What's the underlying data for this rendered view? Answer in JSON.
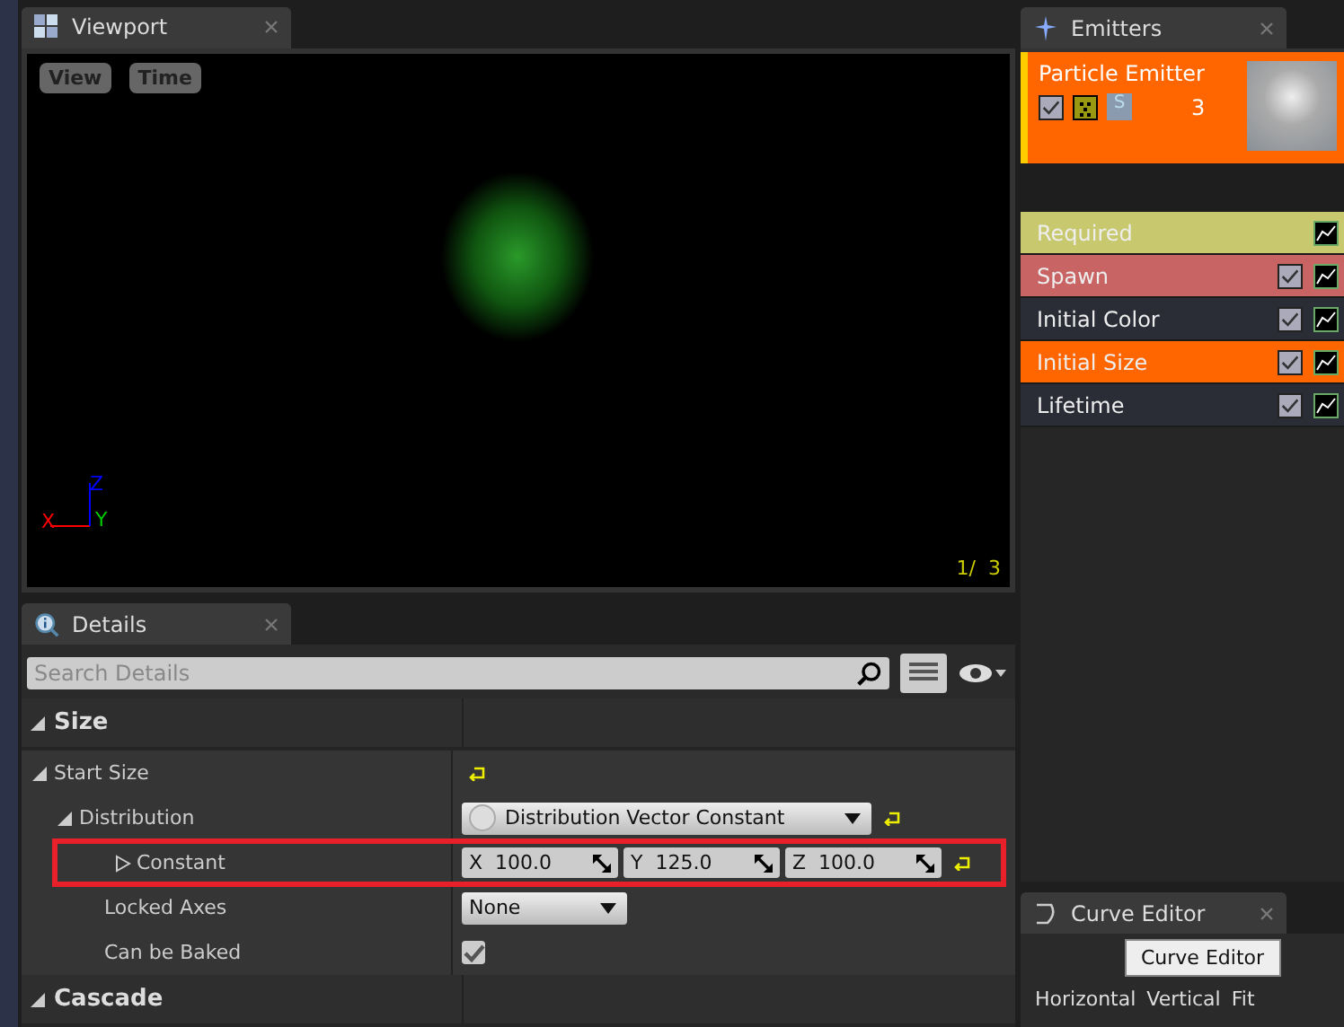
{
  "viewport": {
    "tab": "Viewport",
    "buttons": [
      "View",
      "Time"
    ],
    "axes": {
      "x": "X",
      "y": "Y",
      "z": "Z"
    },
    "counter": "1/  3"
  },
  "details": {
    "tab": "Details",
    "search": {
      "placeholder": "Search Details"
    },
    "sections": [
      {
        "title": "Size",
        "expanded": true,
        "properties": [
          {
            "label": "Start Size",
            "expanded": true,
            "kind": "reset",
            "children": [
              {
                "label": "Distribution",
                "expanded": true,
                "kind": "dropdown",
                "value": "Distribution Vector Constant",
                "reset": true,
                "children": [
                  {
                    "label": "Constant",
                    "expanded": false,
                    "highlighted": true,
                    "kind": "vector",
                    "components": [
                      {
                        "axis": "X",
                        "value": "100.0"
                      },
                      {
                        "axis": "Y",
                        "value": "125.0"
                      },
                      {
                        "axis": "Z",
                        "value": "100.0"
                      }
                    ],
                    "reset": true
                  },
                  {
                    "label": "Locked Axes",
                    "kind": "dropdown",
                    "value": "None"
                  },
                  {
                    "label": "Can be Baked",
                    "kind": "checkbox",
                    "checked": true
                  }
                ]
              }
            ]
          }
        ]
      },
      {
        "title": "Cascade",
        "expanded": true
      }
    ]
  },
  "emitters": {
    "tab": "Emitters",
    "emitter": {
      "name": "Particle Emitter",
      "enabled": true,
      "count": "3",
      "solo_label": "S"
    },
    "modules": [
      {
        "name": "Required",
        "color": "#c8c86e"
      },
      {
        "name": "Spawn",
        "color": "#c86464",
        "checked": true
      },
      {
        "name": "Initial Color",
        "color": "#2a2c36",
        "checked": true
      },
      {
        "name": "Initial Size",
        "color": "#ff6600",
        "checked": true
      },
      {
        "name": "Lifetime",
        "color": "#2a2c36",
        "checked": true
      }
    ]
  },
  "curve_editor": {
    "tab": "Curve Editor",
    "tooltip": "Curve Editor",
    "tools": [
      "Horizontal",
      "Vertical",
      "Fit"
    ]
  }
}
